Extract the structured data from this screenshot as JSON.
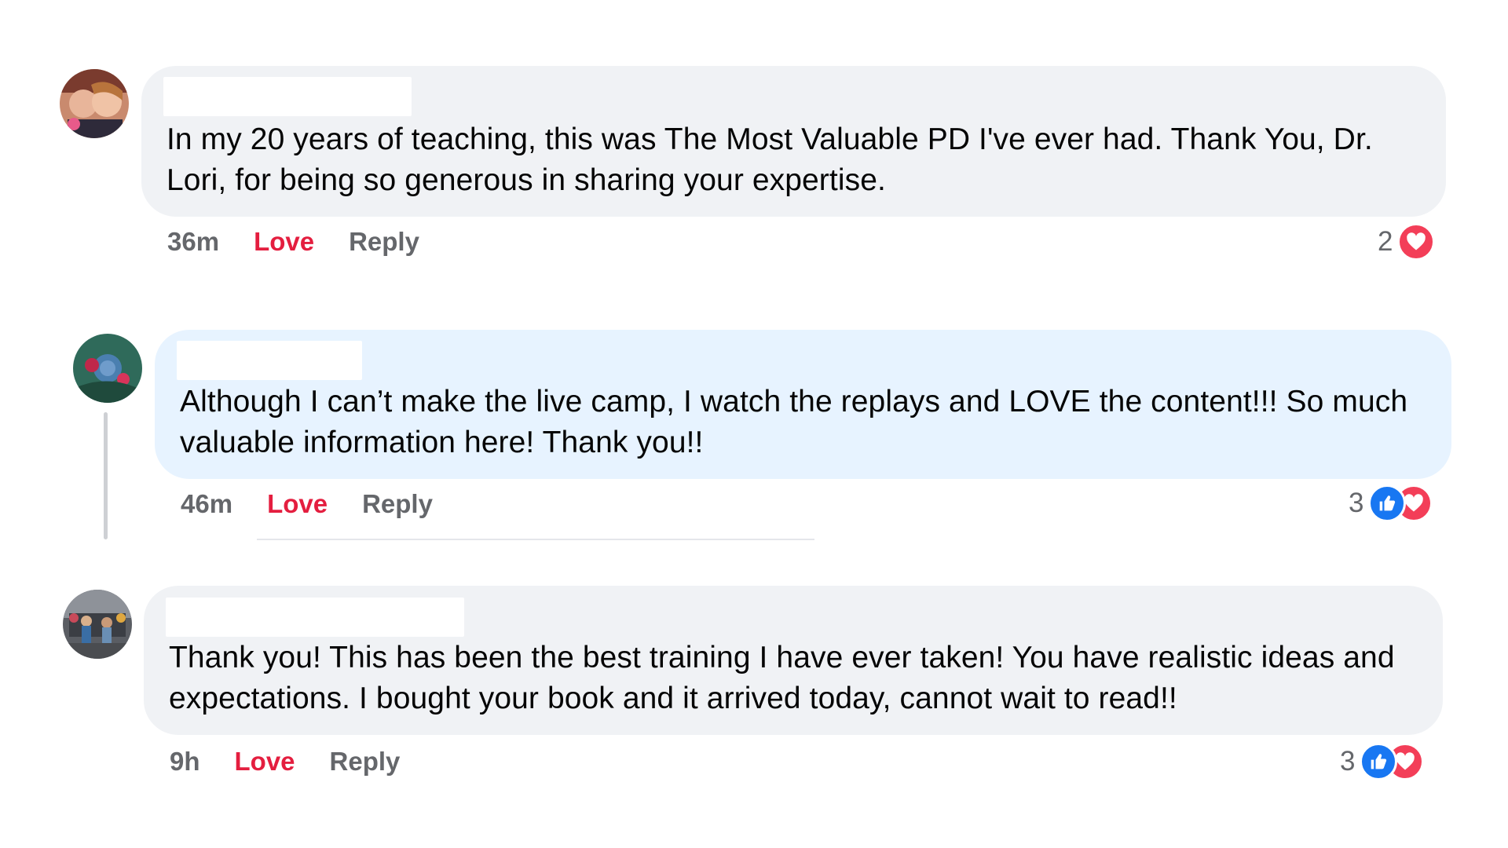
{
  "comments": [
    {
      "text": "In my 20 years of teaching, this was The Most Valuable PD I've ever had. Thank You, Dr. Lori, for being so generous in sharing your expertise.",
      "time": "36m",
      "love_label": "Love",
      "reply_label": "Reply",
      "reaction_count": "2",
      "reactions": [
        "love-icon"
      ]
    },
    {
      "text": "Although I can’t make the live camp, I watch the replays and LOVE the content!!! So much valuable information here! Thank you!!",
      "time": "46m",
      "love_label": "Love",
      "reply_label": "Reply",
      "reaction_count": "3",
      "reactions": [
        "like-icon",
        "love-icon"
      ],
      "highlighted": true
    },
    {
      "text": "Thank you! This has been the best training I have ever taken! You have realistic ideas and expectations. I bought your book and it arrived today, cannot wait to read!!",
      "time": "9h",
      "love_label": "Love",
      "reply_label": "Reply",
      "reaction_count": "3",
      "reactions": [
        "like-icon",
        "love-icon"
      ]
    }
  ],
  "colors": {
    "bubble": "#f0f2f5",
    "bubble_highlight": "#e7f3ff",
    "love_text": "#e41e3f",
    "meta_text": "#65676b",
    "like_blue": "#1877f2",
    "love_red": "#f33e58"
  }
}
